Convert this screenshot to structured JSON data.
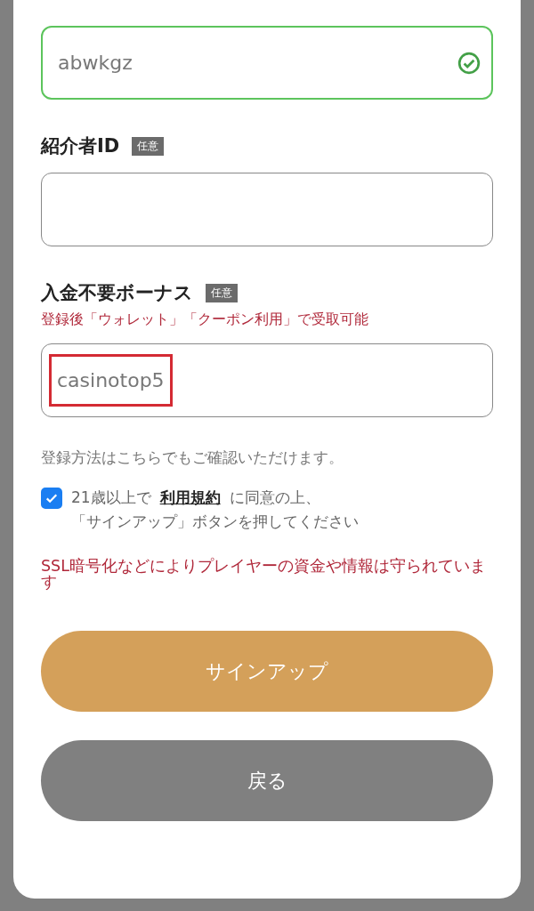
{
  "fields": [
    {
      "value": "abwkgz",
      "valid": true
    },
    {
      "label": "紹介者ID",
      "tag": "任意",
      "valid": false
    },
    {
      "label": "入金不要ボーナス",
      "tag": "任意",
      "note": "登録後「ウォレット」「クーポン利用」で受取可能",
      "value": "casinotop5",
      "valid": false,
      "highlighted": true
    }
  ],
  "info": "登録方法はこちらでもご確認いただけます。",
  "agree": {
    "checked": true,
    "before": "21歳以上で",
    "link": "利用規約",
    "after": "に同意の上、",
    "line2": "「サインアップ」ボタンを押してください"
  },
  "security": "SSL暗号化などによりプレイヤーの資金や情報は守られています",
  "buttons": [
    {
      "label": "サインアップ",
      "kind": "primary"
    },
    {
      "label": "戻る",
      "kind": "secondary"
    }
  ]
}
